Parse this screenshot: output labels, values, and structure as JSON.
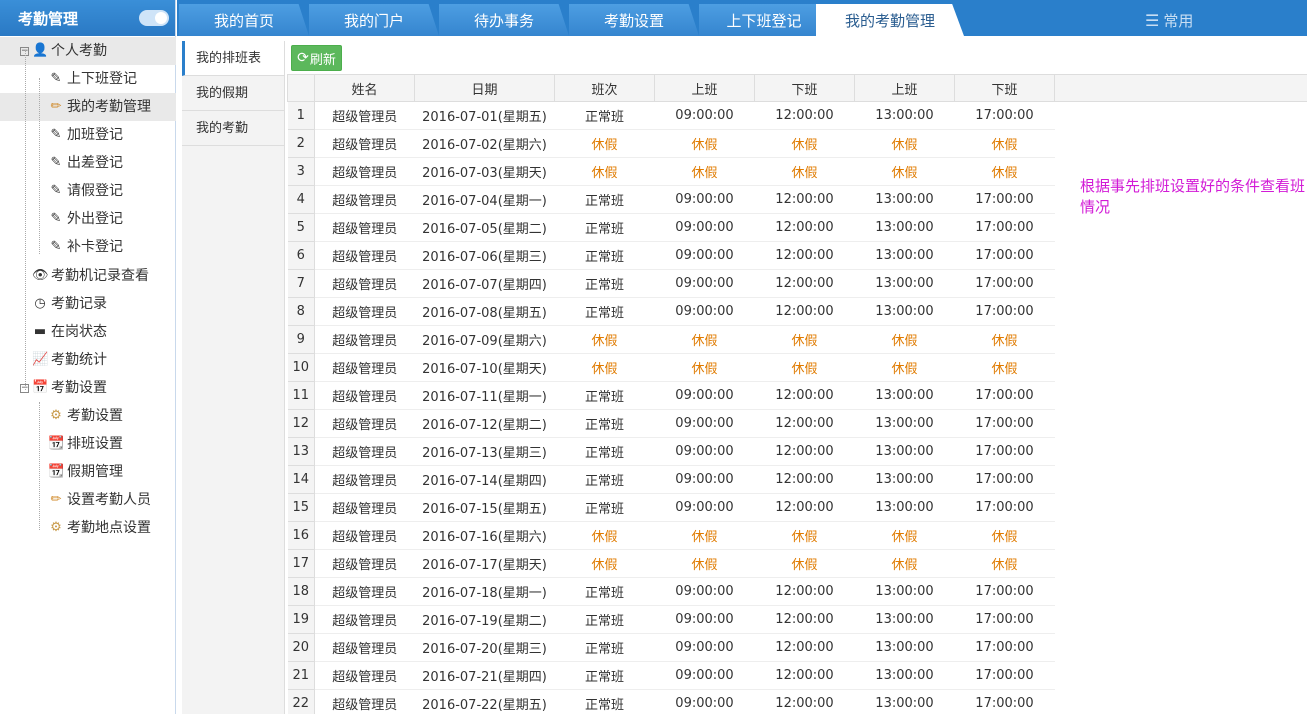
{
  "sidebar": {
    "title": "考勤管理",
    "items": [
      {
        "label": "个人考勤",
        "icon": "user-icon"
      },
      {
        "label": "上下班登记",
        "icon": "edit-icon"
      },
      {
        "label": "我的考勤管理",
        "icon": "pencil-icon"
      },
      {
        "label": "加班登记",
        "icon": "edit-icon"
      },
      {
        "label": "出差登记",
        "icon": "edit-icon"
      },
      {
        "label": "请假登记",
        "icon": "edit-icon"
      },
      {
        "label": "外出登记",
        "icon": "edit-icon"
      },
      {
        "label": "补卡登记",
        "icon": "edit-icon"
      },
      {
        "label": "考勤机记录查看",
        "icon": "eye-icon"
      },
      {
        "label": "考勤记录",
        "icon": "clock-icon"
      },
      {
        "label": "在岗状态",
        "icon": "card-icon"
      },
      {
        "label": "考勤统计",
        "icon": "chart-icon"
      },
      {
        "label": "考勤设置",
        "icon": "calendar-plus-icon"
      },
      {
        "label": "考勤设置",
        "icon": "gear-icon"
      },
      {
        "label": "排班设置",
        "icon": "calendar-icon"
      },
      {
        "label": "假期管理",
        "icon": "calendar-icon"
      },
      {
        "label": "设置考勤人员",
        "icon": "pencil-icon"
      },
      {
        "label": "考勤地点设置",
        "icon": "gear-icon"
      }
    ]
  },
  "top_tabs": [
    "我的首页",
    "我的门户",
    "待办事务",
    "考勤设置",
    "上下班登记",
    "我的考勤管理"
  ],
  "common_label": "常用",
  "sub_tabs": [
    "我的排班表",
    "我的假期",
    "我的考勤"
  ],
  "toolbar": {
    "refresh_label": "刷新"
  },
  "table": {
    "headers": [
      "姓名",
      "日期",
      "班次",
      "上班",
      "下班",
      "上班",
      "下班"
    ],
    "rows": [
      [
        "1",
        "超级管理员",
        "2016-07-01(星期五)",
        "正常班",
        "09:00:00",
        "12:00:00",
        "13:00:00",
        "17:00:00"
      ],
      [
        "2",
        "超级管理员",
        "2016-07-02(星期六)",
        "休假",
        "休假",
        "休假",
        "休假",
        "休假"
      ],
      [
        "3",
        "超级管理员",
        "2016-07-03(星期天)",
        "休假",
        "休假",
        "休假",
        "休假",
        "休假"
      ],
      [
        "4",
        "超级管理员",
        "2016-07-04(星期一)",
        "正常班",
        "09:00:00",
        "12:00:00",
        "13:00:00",
        "17:00:00"
      ],
      [
        "5",
        "超级管理员",
        "2016-07-05(星期二)",
        "正常班",
        "09:00:00",
        "12:00:00",
        "13:00:00",
        "17:00:00"
      ],
      [
        "6",
        "超级管理员",
        "2016-07-06(星期三)",
        "正常班",
        "09:00:00",
        "12:00:00",
        "13:00:00",
        "17:00:00"
      ],
      [
        "7",
        "超级管理员",
        "2016-07-07(星期四)",
        "正常班",
        "09:00:00",
        "12:00:00",
        "13:00:00",
        "17:00:00"
      ],
      [
        "8",
        "超级管理员",
        "2016-07-08(星期五)",
        "正常班",
        "09:00:00",
        "12:00:00",
        "13:00:00",
        "17:00:00"
      ],
      [
        "9",
        "超级管理员",
        "2016-07-09(星期六)",
        "休假",
        "休假",
        "休假",
        "休假",
        "休假"
      ],
      [
        "10",
        "超级管理员",
        "2016-07-10(星期天)",
        "休假",
        "休假",
        "休假",
        "休假",
        "休假"
      ],
      [
        "11",
        "超级管理员",
        "2016-07-11(星期一)",
        "正常班",
        "09:00:00",
        "12:00:00",
        "13:00:00",
        "17:00:00"
      ],
      [
        "12",
        "超级管理员",
        "2016-07-12(星期二)",
        "正常班",
        "09:00:00",
        "12:00:00",
        "13:00:00",
        "17:00:00"
      ],
      [
        "13",
        "超级管理员",
        "2016-07-13(星期三)",
        "正常班",
        "09:00:00",
        "12:00:00",
        "13:00:00",
        "17:00:00"
      ],
      [
        "14",
        "超级管理员",
        "2016-07-14(星期四)",
        "正常班",
        "09:00:00",
        "12:00:00",
        "13:00:00",
        "17:00:00"
      ],
      [
        "15",
        "超级管理员",
        "2016-07-15(星期五)",
        "正常班",
        "09:00:00",
        "12:00:00",
        "13:00:00",
        "17:00:00"
      ],
      [
        "16",
        "超级管理员",
        "2016-07-16(星期六)",
        "休假",
        "休假",
        "休假",
        "休假",
        "休假"
      ],
      [
        "17",
        "超级管理员",
        "2016-07-17(星期天)",
        "休假",
        "休假",
        "休假",
        "休假",
        "休假"
      ],
      [
        "18",
        "超级管理员",
        "2016-07-18(星期一)",
        "正常班",
        "09:00:00",
        "12:00:00",
        "13:00:00",
        "17:00:00"
      ],
      [
        "19",
        "超级管理员",
        "2016-07-19(星期二)",
        "正常班",
        "09:00:00",
        "12:00:00",
        "13:00:00",
        "17:00:00"
      ],
      [
        "20",
        "超级管理员",
        "2016-07-20(星期三)",
        "正常班",
        "09:00:00",
        "12:00:00",
        "13:00:00",
        "17:00:00"
      ],
      [
        "21",
        "超级管理员",
        "2016-07-21(星期四)",
        "正常班",
        "09:00:00",
        "12:00:00",
        "13:00:00",
        "17:00:00"
      ],
      [
        "22",
        "超级管理员",
        "2016-07-22(星期五)",
        "正常班",
        "09:00:00",
        "12:00:00",
        "13:00:00",
        "17:00:00"
      ]
    ]
  },
  "note": "根据事先排班设置好的条件查看班情况",
  "colors": {
    "brand": "#2a7fcb",
    "holiday": "#e07b00",
    "note": "#d21bd6",
    "refresh": "#5cb85c"
  }
}
